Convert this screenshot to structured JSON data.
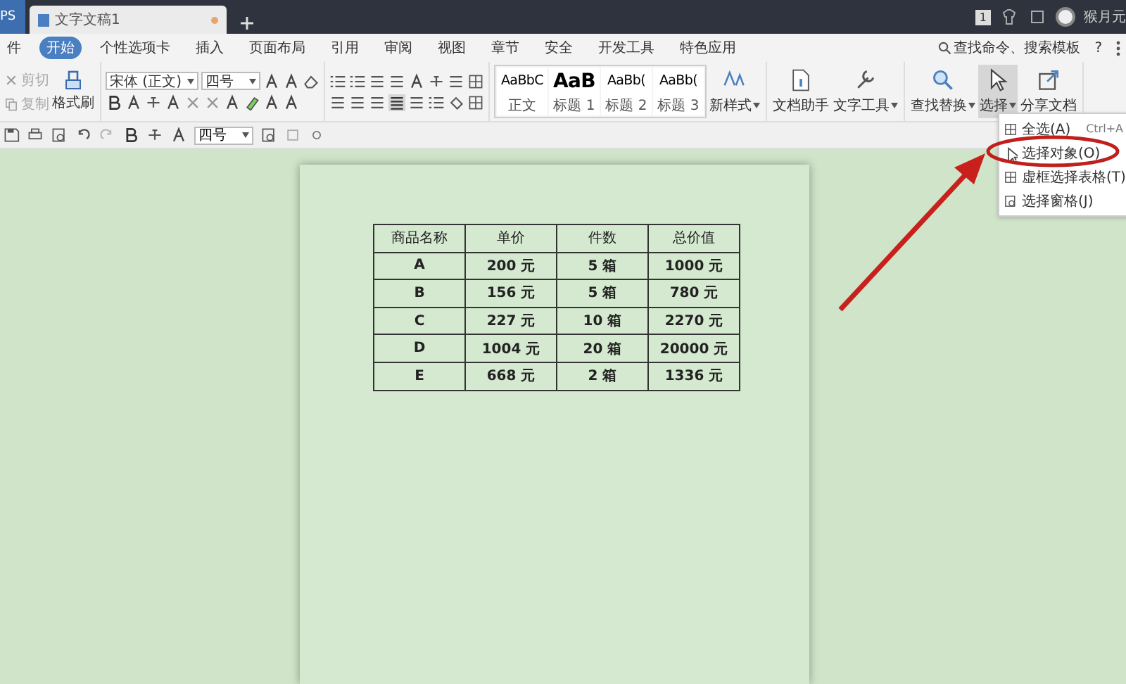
{
  "title_bar": {
    "app_tab": "PS",
    "doc_tab": "文字文稿1",
    "badge": "1",
    "user": "猴月元"
  },
  "menu": [
    {
      "label": "件",
      "selected": false
    },
    {
      "label": "开始",
      "selected": true
    },
    {
      "label": "个性选项卡",
      "selected": false
    },
    {
      "label": "插入",
      "selected": false
    },
    {
      "label": "页面布局",
      "selected": false
    },
    {
      "label": "引用",
      "selected": false
    },
    {
      "label": "审阅",
      "selected": false
    },
    {
      "label": "视图",
      "selected": false
    },
    {
      "label": "章节",
      "selected": false
    },
    {
      "label": "安全",
      "selected": false
    },
    {
      "label": "开发工具",
      "selected": false
    },
    {
      "label": "特色应用",
      "selected": false
    }
  ],
  "search": "查找命令、搜索模板",
  "help": "?",
  "ribbon": {
    "clipboard": [
      {
        "label": "剪切",
        "disabled": true
      },
      {
        "label": "复制",
        "disabled": true
      }
    ],
    "format_painter": "格式刷",
    "font": "宋体 (正文)",
    "size": "四号",
    "styles": [
      {
        "preview": "AaBbC",
        "label": "正文"
      },
      {
        "preview": "AaB",
        "label": "标题 1"
      },
      {
        "preview": "AaBb(",
        "label": "标题 2"
      },
      {
        "preview": "AaBb(",
        "label": "标题 3"
      }
    ],
    "tools": [
      {
        "label": "新样式",
        "kind": "styles",
        "dropdown": true,
        "selected": false
      },
      {
        "label": "文档助手",
        "kind": "doc",
        "dropdown": false,
        "selected": false
      },
      {
        "label": "文字工具",
        "kind": "wrench",
        "dropdown": true,
        "selected": false
      },
      {
        "label": "查找替换",
        "kind": "search",
        "dropdown": true,
        "selected": false
      },
      {
        "label": "选择",
        "kind": "cursor",
        "dropdown": true,
        "selected": true
      },
      {
        "label": "分享文档",
        "kind": "share",
        "dropdown": false,
        "selected": false
      }
    ]
  },
  "quick_bar": {
    "size": "四号"
  },
  "table": {
    "columns": [
      "商品名称",
      "单价",
      "件数",
      "总价值"
    ],
    "rows": [
      [
        "A",
        "200 元",
        "5 箱",
        "1000 元"
      ],
      [
        "B",
        "156 元",
        "5 箱",
        "780 元"
      ],
      [
        "C",
        "227 元",
        "10 箱",
        "2270 元"
      ],
      [
        "D",
        "1004 元",
        "20 箱",
        "20000 元"
      ],
      [
        "E",
        "668 元",
        "2 箱",
        "1336 元"
      ]
    ]
  },
  "select_menu": [
    {
      "label": "全选(A)",
      "shortcut": "Ctrl+A"
    },
    {
      "label": "选择对象(O)"
    },
    {
      "label": "虚框选择表格(T)"
    },
    {
      "label": "选择窗格(J)"
    }
  ]
}
